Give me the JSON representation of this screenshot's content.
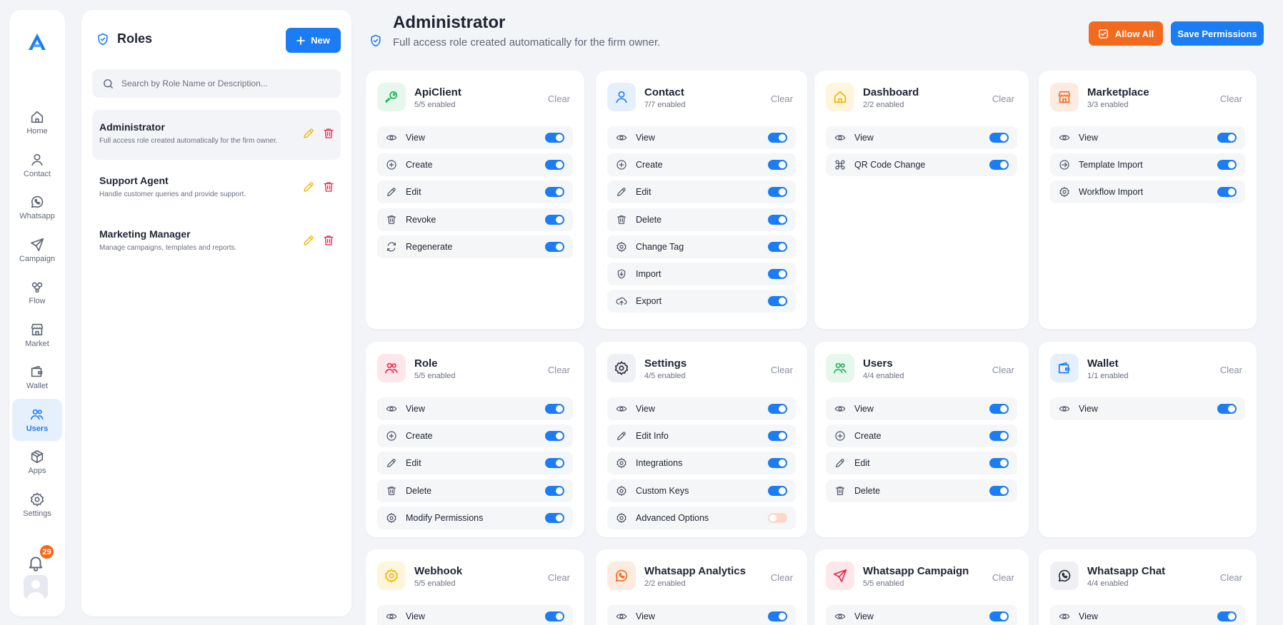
{
  "nav": {
    "items": [
      {
        "label": "Home",
        "icon": "home-icon"
      },
      {
        "label": "Contact",
        "icon": "user-icon"
      },
      {
        "label": "Whatsapp",
        "icon": "whatsapp-icon"
      },
      {
        "label": "Campaign",
        "icon": "send-icon"
      },
      {
        "label": "Flow",
        "icon": "flow-icon"
      },
      {
        "label": "Market",
        "icon": "store-icon"
      },
      {
        "label": "Wallet",
        "icon": "wallet-icon"
      },
      {
        "label": "Users",
        "icon": "users-icon",
        "active": true
      },
      {
        "label": "Apps",
        "icon": "apps-icon"
      },
      {
        "label": "Settings",
        "icon": "gear-icon"
      }
    ],
    "notification_count": "29"
  },
  "roles_panel": {
    "title": "Roles",
    "new_label": "New",
    "search_placeholder": "Search by Role Name or Description...",
    "roles": [
      {
        "name": "Administrator",
        "description": "Full access role created automatically for the firm owner.",
        "selected": true
      },
      {
        "name": "Support Agent",
        "description": "Handle customer queries and provide support."
      },
      {
        "name": "Marketing Manager",
        "description": "Manage campaigns, templates and reports."
      }
    ]
  },
  "header": {
    "title": "Administrator",
    "subtitle": "Full access role created automatically for the firm owner.",
    "allow_all_label": "Allow All",
    "save_label": "Save Permissions"
  },
  "clear_label": "Clear",
  "modules": [
    {
      "name": "ApiClient",
      "enabled_text": "5/5 enabled",
      "icon": "key-icon",
      "tint": "#e6f8ec",
      "color": "#22b356",
      "perms": [
        {
          "label": "View",
          "icon": "eye",
          "on": true
        },
        {
          "label": "Create",
          "icon": "plus",
          "on": true
        },
        {
          "label": "Edit",
          "icon": "pencil",
          "on": true
        },
        {
          "label": "Revoke",
          "icon": "trash",
          "on": true
        },
        {
          "label": "Regenerate",
          "icon": "refresh",
          "on": true
        }
      ]
    },
    {
      "name": "Contact",
      "enabled_text": "7/7 enabled",
      "icon": "user-icon",
      "tint": "#e6f0fd",
      "color": "#1b7cf3",
      "perms": [
        {
          "label": "View",
          "icon": "eye",
          "on": true
        },
        {
          "label": "Create",
          "icon": "plus",
          "on": true
        },
        {
          "label": "Edit",
          "icon": "pencil",
          "on": true
        },
        {
          "label": "Delete",
          "icon": "trash",
          "on": true
        },
        {
          "label": "Change Tag",
          "icon": "gear",
          "on": true
        },
        {
          "label": "Import",
          "icon": "import",
          "on": true
        },
        {
          "label": "Export",
          "icon": "upload",
          "on": true
        }
      ]
    },
    {
      "name": "Dashboard",
      "enabled_text": "2/2 enabled",
      "icon": "home-icon",
      "tint": "#fef6dc",
      "color": "#f0b400",
      "perms": [
        {
          "label": "View",
          "icon": "eye",
          "on": true
        },
        {
          "label": "QR Code Change",
          "icon": "command",
          "on": true
        }
      ]
    },
    {
      "name": "Marketplace",
      "enabled_text": "3/3 enabled",
      "icon": "store-icon",
      "tint": "#fdebe0",
      "color": "#f3691e",
      "perms": [
        {
          "label": "View",
          "icon": "eye",
          "on": true
        },
        {
          "label": "Template Import",
          "icon": "circle-import",
          "on": true
        },
        {
          "label": "Workflow Import",
          "icon": "gear",
          "on": true
        }
      ]
    },
    {
      "name": "Role",
      "enabled_text": "5/5 enabled",
      "icon": "users-icon",
      "tint": "#fde7ea",
      "color": "#e8294a",
      "perms": [
        {
          "label": "View",
          "icon": "eye",
          "on": true
        },
        {
          "label": "Create",
          "icon": "plus",
          "on": true
        },
        {
          "label": "Edit",
          "icon": "pencil",
          "on": true
        },
        {
          "label": "Delete",
          "icon": "trash",
          "on": true
        },
        {
          "label": "Modify Permissions",
          "icon": "gear",
          "on": true
        }
      ]
    },
    {
      "name": "Settings",
      "enabled_text": "4/5 enabled",
      "icon": "gear-icon",
      "tint": "#eef0f3",
      "color": "#2a2f3c",
      "perms": [
        {
          "label": "View",
          "icon": "eye",
          "on": true
        },
        {
          "label": "Edit Info",
          "icon": "pencil",
          "on": true
        },
        {
          "label": "Integrations",
          "icon": "gear",
          "on": true
        },
        {
          "label": "Custom Keys",
          "icon": "gear",
          "on": true
        },
        {
          "label": "Advanced Options",
          "icon": "gear-eye",
          "on": false
        }
      ]
    },
    {
      "name": "Users",
      "enabled_text": "4/4 enabled",
      "icon": "users-icon",
      "tint": "#e6f8ec",
      "color": "#22b356",
      "perms": [
        {
          "label": "View",
          "icon": "eye",
          "on": true
        },
        {
          "label": "Create",
          "icon": "plus",
          "on": true
        },
        {
          "label": "Edit",
          "icon": "pencil",
          "on": true
        },
        {
          "label": "Delete",
          "icon": "trash",
          "on": true
        }
      ]
    },
    {
      "name": "Wallet",
      "enabled_text": "1/1 enabled",
      "icon": "wallet-icon",
      "tint": "#e6f0fd",
      "color": "#1b7cf3",
      "perms": [
        {
          "label": "View",
          "icon": "eye",
          "on": true
        }
      ]
    },
    {
      "name": "Webhook",
      "enabled_text": "5/5 enabled",
      "icon": "gear-icon",
      "tint": "#fef6dc",
      "color": "#f0b400",
      "perms": [
        {
          "label": "View",
          "icon": "eye",
          "on": true
        }
      ]
    },
    {
      "name": "Whatsapp Analytics",
      "enabled_text": "2/2 enabled",
      "icon": "whatsapp-icon",
      "tint": "#fdebe0",
      "color": "#f3691e",
      "perms": [
        {
          "label": "View",
          "icon": "eye",
          "on": true
        }
      ]
    },
    {
      "name": "Whatsapp Campaign",
      "enabled_text": "5/5 enabled",
      "icon": "send-icon",
      "tint": "#fde7ea",
      "color": "#e8294a",
      "perms": [
        {
          "label": "View",
          "icon": "eye",
          "on": true
        }
      ]
    },
    {
      "name": "Whatsapp Chat",
      "enabled_text": "4/4 enabled",
      "icon": "whatsapp-icon",
      "tint": "#eef0f3",
      "color": "#2a2f3c",
      "perms": [
        {
          "label": "View",
          "icon": "eye",
          "on": true
        }
      ]
    }
  ]
}
